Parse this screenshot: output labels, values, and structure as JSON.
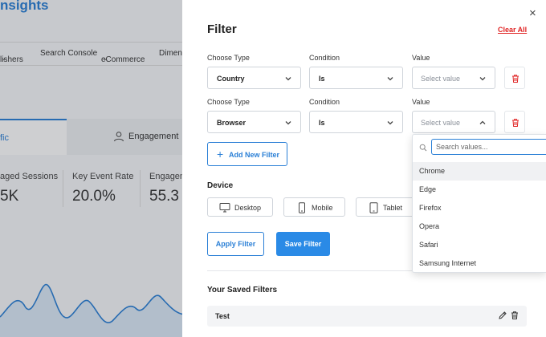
{
  "background": {
    "title": "nsights",
    "nav": [
      {
        "label": "lishers",
        "caret": "⌄"
      },
      {
        "label": "Search Console",
        "caret": ""
      },
      {
        "label": "eCommerce",
        "caret": "⌄"
      },
      {
        "label": "Dimens",
        "caret": ""
      }
    ],
    "tabs": {
      "active": "fic",
      "other": "Engagement"
    },
    "metrics": [
      {
        "label": "aged Sessions",
        "value": "5K"
      },
      {
        "label": "Key Event Rate",
        "value": "20.0%"
      },
      {
        "label": "Engagem",
        "value": "55.3"
      }
    ]
  },
  "drawer": {
    "title": "Filter",
    "clear_all": "Clear All",
    "close_glyph": "×",
    "rows": [
      {
        "type_label": "Choose Type",
        "condition_label": "Condition",
        "value_label": "Value",
        "type": "Country",
        "condition": "Is",
        "value_placeholder": "Select value"
      },
      {
        "type_label": "Choose Type",
        "condition_label": "Condition",
        "value_label": "Value",
        "type": "Browser",
        "condition": "Is",
        "value_placeholder": "Select value"
      }
    ],
    "add_filter": {
      "plus": "+",
      "label": "Add New Filter"
    },
    "device": {
      "label": "Device",
      "options": [
        "Desktop",
        "Mobile",
        "Tablet"
      ]
    },
    "apply": "Apply Filter",
    "save": "Save Filter",
    "saved": {
      "title": "Your Saved Filters",
      "items": [
        "Test"
      ]
    }
  },
  "dropdown": {
    "search_placeholder": "Search values...",
    "options": [
      "Chrome",
      "Edge",
      "Firefox",
      "Opera",
      "Safari",
      "Samsung Internet"
    ],
    "highlighted_index": 0
  },
  "colors": {
    "accent": "#2a7fd6",
    "danger": "#e02424",
    "primary_button": "#2a8ae6"
  }
}
